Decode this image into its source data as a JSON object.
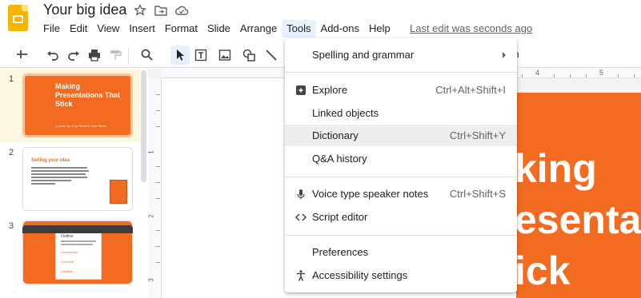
{
  "app": {
    "title": "Your big idea",
    "last_edit": "Last edit was seconds ago"
  },
  "menubar": [
    "File",
    "Edit",
    "View",
    "Insert",
    "Format",
    "Slide",
    "Arrange",
    "Tools",
    "Add-ons",
    "Help"
  ],
  "toolbar": {
    "truncated_label": "n"
  },
  "filmstrip": {
    "slides": [
      {
        "number": "1",
        "title": "Making Presentations That Stick",
        "subtitle": "A guide by Chip Heath & Dan Heath"
      },
      {
        "number": "2",
        "title": "Selling your idea"
      },
      {
        "number": "3",
        "card_title": "Outline",
        "items": [
          "Unexpected",
          "Concrete",
          "Credible"
        ]
      }
    ]
  },
  "ruler": {
    "h_labels": [
      "4",
      "5"
    ],
    "v_labels": [
      "1",
      "2",
      "3"
    ]
  },
  "slide_main": {
    "lines": [
      "king",
      "esentat",
      "ick"
    ]
  },
  "tools_menu": {
    "spelling": {
      "label": "Spelling and grammar"
    },
    "explore": {
      "label": "Explore",
      "shortcut": "Ctrl+Alt+Shift+I"
    },
    "linked": {
      "label": "Linked objects"
    },
    "dictionary": {
      "label": "Dictionary",
      "shortcut": "Ctrl+Shift+Y"
    },
    "qa": {
      "label": "Q&A history"
    },
    "voice": {
      "label": "Voice type speaker notes",
      "shortcut": "Ctrl+Shift+S"
    },
    "script": {
      "label": "Script editor"
    },
    "prefs": {
      "label": "Preferences"
    },
    "access": {
      "label": "Accessibility settings"
    }
  },
  "colors": {
    "accent_orange": "#f26b21",
    "slides_yellow": "#f4b400",
    "menu_hover": "#eeeeee"
  }
}
